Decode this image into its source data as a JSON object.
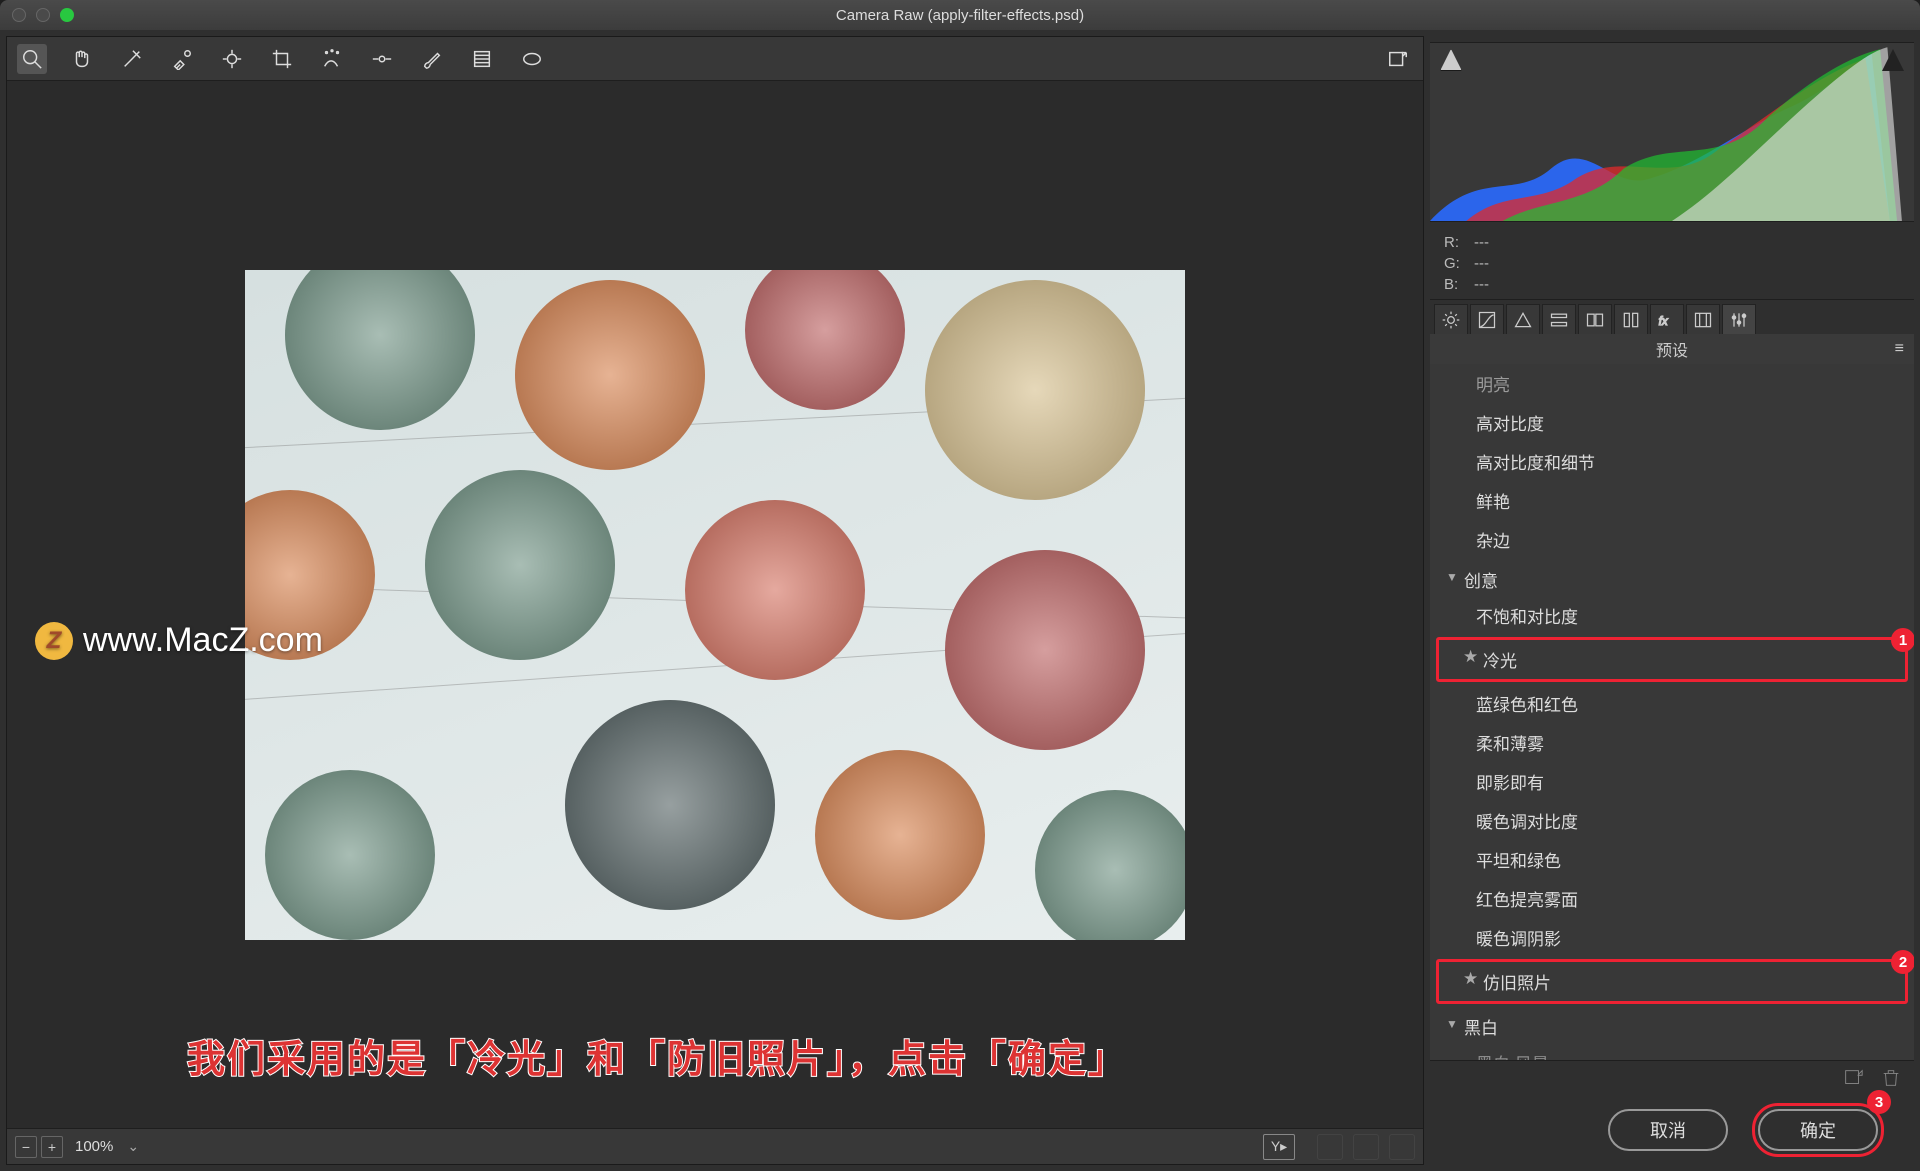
{
  "window": {
    "title": "Camera Raw (apply-filter-effects.psd)"
  },
  "toolbar": {
    "tools": [
      "zoom",
      "hand",
      "white-balance",
      "color-sampler",
      "target",
      "crop",
      "spot",
      "alignment",
      "brush",
      "gradient",
      "radial",
      "export"
    ]
  },
  "zoom": {
    "value": "100%"
  },
  "watermark": {
    "badge": "Z",
    "text": "www.MacZ.com"
  },
  "annotation": {
    "text": "我们采用的是「冷光」和「防旧照片」，点击「确定」"
  },
  "rgb": {
    "r_label": "R:",
    "r": "---",
    "g_label": "G:",
    "g": "---",
    "b_label": "B:",
    "b": "---"
  },
  "panel": {
    "title": "预设"
  },
  "presets": {
    "partial_top": "明亮",
    "items_top": [
      "高对比度",
      "高对比度和细节",
      "鲜艳",
      "杂边"
    ],
    "group1": "创意",
    "group1_items": [
      "不饱和对比度",
      "冷光",
      "蓝绿色和红色",
      "柔和薄雾",
      "即影即有",
      "暖色调对比度",
      "平坦和绿色",
      "红色提亮雾面",
      "暖色调阴影",
      "仿旧照片"
    ],
    "group2": "黑白",
    "group2_items_partial": [
      "黑白 风景"
    ]
  },
  "callouts": {
    "one": "1",
    "two": "2",
    "three": "3"
  },
  "buttons": {
    "cancel": "取消",
    "ok": "确定"
  }
}
